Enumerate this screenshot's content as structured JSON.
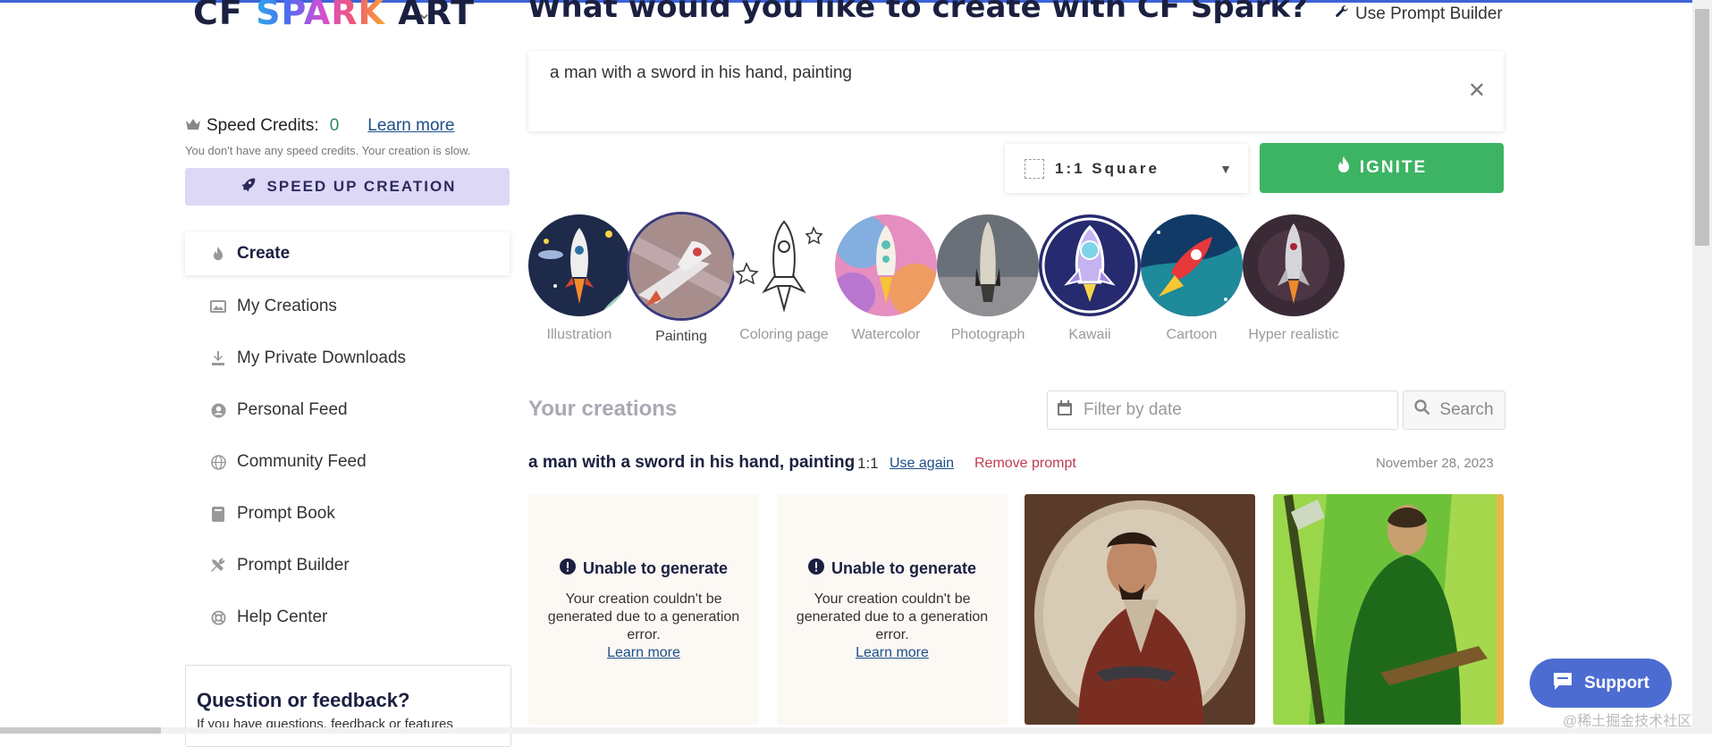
{
  "brand": {
    "logo_cf": "CF",
    "logo_spark": "SPARK",
    "logo_art": "ART"
  },
  "header": {
    "title": "What would you like to create with CF Spark?",
    "prompt_builder_link": "Use Prompt Builder"
  },
  "prompt": {
    "value": "a man with a sword in his hand, painting"
  },
  "controls": {
    "aspect_label": "1:1 Square",
    "ignite_label": "IGNITE"
  },
  "sidebar": {
    "credits_label": "Speed Credits:",
    "credits_value": "0",
    "credits_learn": "Learn more",
    "credits_note": "You don't have any speed credits. Your creation is slow.",
    "speed_up_label": "SPEED UP CREATION",
    "nav": [
      {
        "label": "Create",
        "icon": "fire-icon"
      },
      {
        "label": "My Creations",
        "icon": "images-icon"
      },
      {
        "label": "My Private Downloads",
        "icon": "download-icon"
      },
      {
        "label": "Personal Feed",
        "icon": "user-circle-icon"
      },
      {
        "label": "Community Feed",
        "icon": "globe-icon"
      },
      {
        "label": "Prompt Book",
        "icon": "book-icon"
      },
      {
        "label": "Prompt Builder",
        "icon": "tools-icon"
      },
      {
        "label": "Help Center",
        "icon": "lifebuoy-icon"
      }
    ],
    "feedback_title": "Question or feedback?",
    "feedback_text": "If you have questions, feedback or features"
  },
  "styles": [
    {
      "label": "Illustration",
      "selected": false
    },
    {
      "label": "Painting",
      "selected": true
    },
    {
      "label": "Coloring page",
      "selected": false
    },
    {
      "label": "Watercolor",
      "selected": false
    },
    {
      "label": "Photograph",
      "selected": false
    },
    {
      "label": "Kawaii",
      "selected": false
    },
    {
      "label": "Cartoon",
      "selected": false
    },
    {
      "label": "Hyper realistic",
      "selected": false
    }
  ],
  "creations": {
    "heading": "Your creations",
    "filter_placeholder": "Filter by date",
    "search_label": "Search",
    "row": {
      "prompt": "a man with a sword in his hand, painting",
      "ratio": "1:1",
      "use_again": "Use again",
      "remove": "Remove prompt",
      "date": "November 28, 2023"
    },
    "error_title": "Unable to generate",
    "error_text": "Your creation couldn't be generated due to a generation error.",
    "error_learn": "Learn more"
  },
  "support_label": "Support",
  "watermark": "@稀土掘金技术社区",
  "colors": {
    "ignite": "#3cb463",
    "accent": "#3d63d8",
    "support": "#4d6cd1",
    "speedup_bg": "#ddd8f5",
    "remove": "#c03a50"
  }
}
